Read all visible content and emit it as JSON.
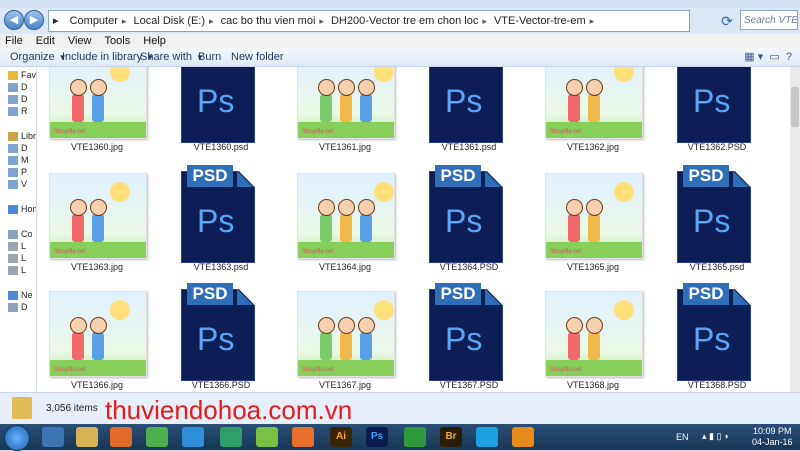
{
  "address": {
    "segments": [
      "Computer",
      "Local Disk (E:)",
      "cac bo thu vien moi",
      "DH200-Vector tre em chon loc",
      "VTE-Vector-tre-em"
    ],
    "search_placeholder": "Search VTE-..."
  },
  "menu": [
    "File",
    "Edit",
    "View",
    "Tools",
    "Help"
  ],
  "toolbar": {
    "organize": "Organize",
    "include": "Include in library",
    "share": "Share with",
    "burn": "Burn",
    "new_folder": "New folder"
  },
  "nav": [
    "Fav",
    "D",
    "D",
    "R",
    "Libr",
    "D",
    "M",
    "P",
    "V",
    "Hom",
    "Co",
    "L",
    "L",
    "L",
    "Ne",
    "D"
  ],
  "files": [
    {
      "name": "VTE1360.jpg",
      "kind": "jpg"
    },
    {
      "name": "VTE1360.psd",
      "kind": "psd"
    },
    {
      "name": "VTE1361.jpg",
      "kind": "jpg"
    },
    {
      "name": "VTE1361.psd",
      "kind": "psd"
    },
    {
      "name": "VTE1362.jpg",
      "kind": "jpg"
    },
    {
      "name": "VTE1362.PSD",
      "kind": "psd"
    },
    {
      "name": "VTE1363.jpg",
      "kind": "jpg"
    },
    {
      "name": "VTE1363.psd",
      "kind": "psd"
    },
    {
      "name": "VTE1364.jpg",
      "kind": "jpg"
    },
    {
      "name": "VTE1364.PSD",
      "kind": "psd"
    },
    {
      "name": "VTE1365.jpg",
      "kind": "jpg"
    },
    {
      "name": "VTE1365.psd",
      "kind": "psd"
    },
    {
      "name": "VTE1366.jpg",
      "kind": "jpg"
    },
    {
      "name": "VTE1366.PSD",
      "kind": "psd"
    },
    {
      "name": "VTE1367.jpg",
      "kind": "jpg"
    },
    {
      "name": "VTE1367.PSD",
      "kind": "psd"
    },
    {
      "name": "VTE1368.jpg",
      "kind": "jpg"
    },
    {
      "name": "VTE1368.PSD",
      "kind": "psd"
    }
  ],
  "psd_icon": {
    "tag": "PSD",
    "glyph": "Ps"
  },
  "thumb_watermark": "Shopfile.net",
  "status": {
    "count": "3,056 items",
    "watermark": "thuviendohoa.com.vn"
  },
  "taskbar": {
    "apps": [
      "explorer",
      "folder",
      "media-player",
      "chrome",
      "ie",
      "app-a",
      "app-b",
      "firefox",
      "Ai",
      "Ps",
      "app-c",
      "Br",
      "skype",
      "app-d"
    ],
    "lang": "EN",
    "time": "10:09 PM",
    "date": "04-Jan-16"
  },
  "colors": {
    "psd_body": "#0d1d55",
    "psd_accent": "#2f6fb7",
    "watermark": "#e31b1b"
  }
}
